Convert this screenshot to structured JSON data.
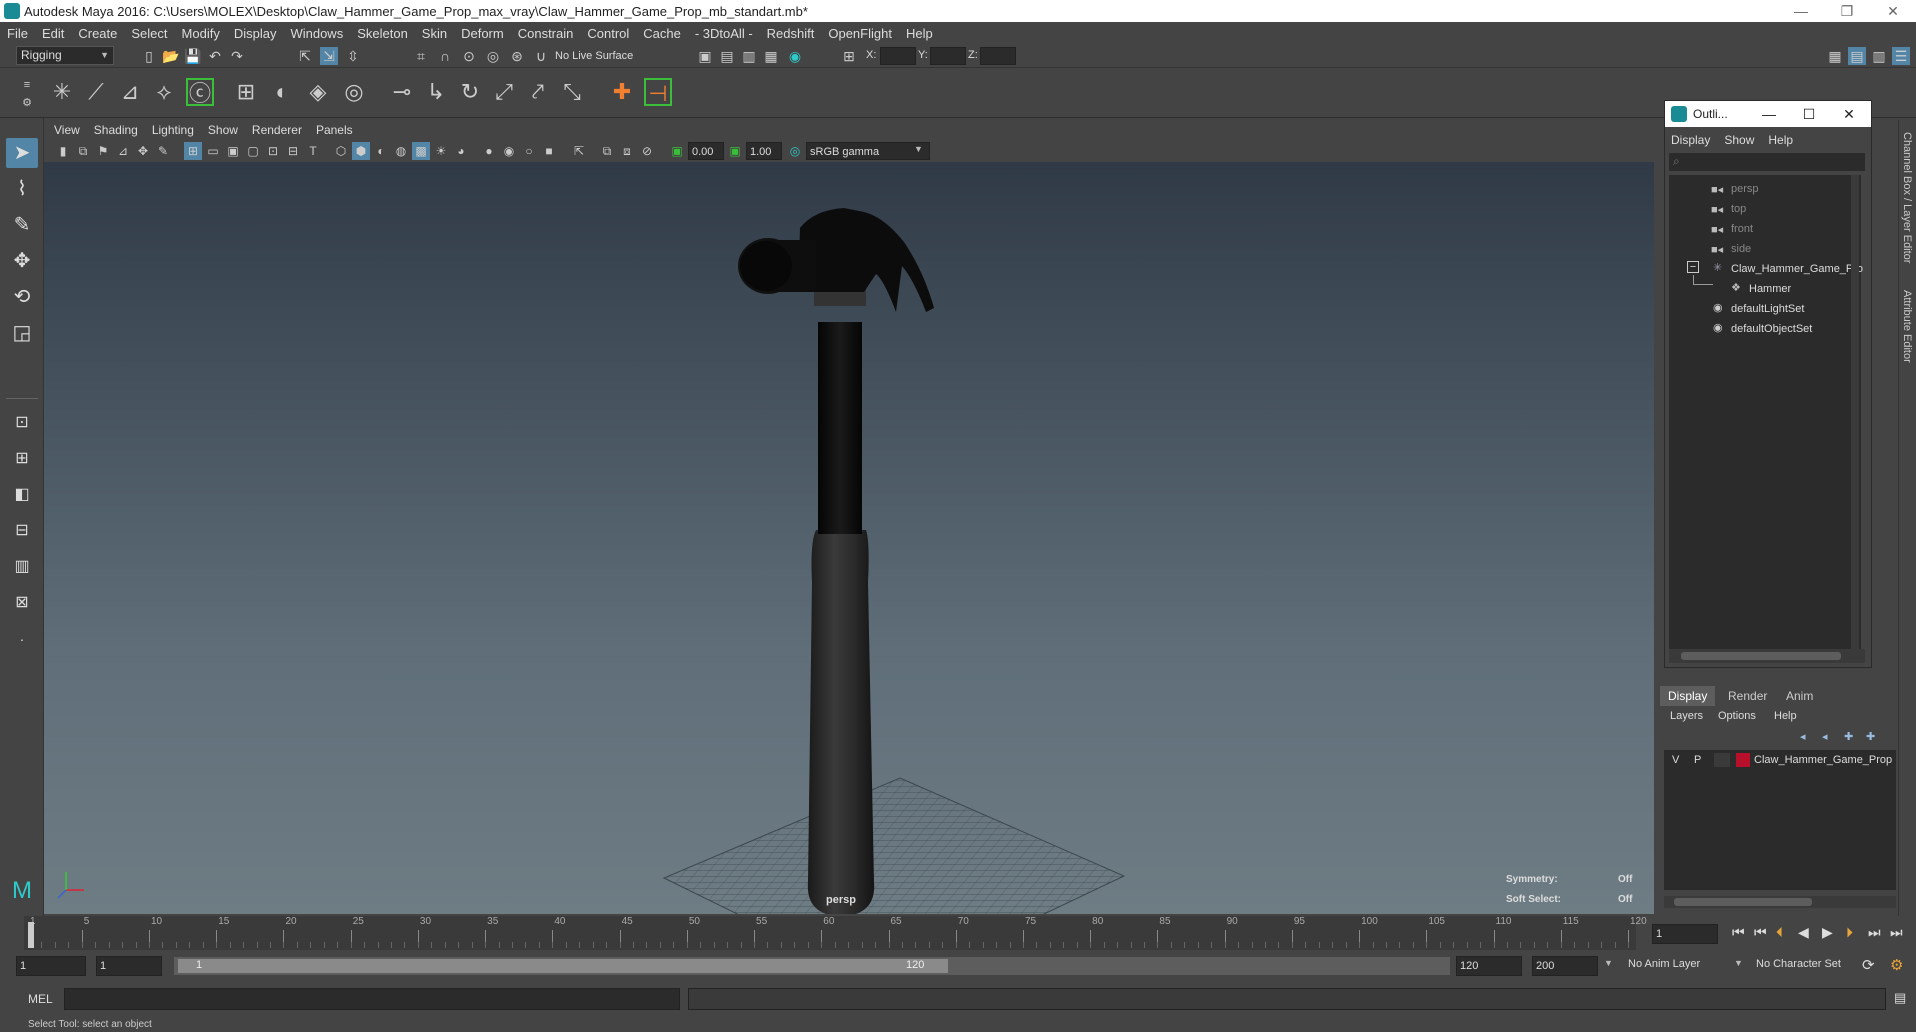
{
  "window": {
    "title": "Autodesk Maya 2016: C:\\Users\\MOLEX\\Desktop\\Claw_Hammer_Game_Prop_max_vray\\Claw_Hammer_Game_Prop_mb_standart.mb*"
  },
  "menubar": [
    "File",
    "Edit",
    "Create",
    "Select",
    "Modify",
    "Display",
    "Windows",
    "Skeleton",
    "Skin",
    "Deform",
    "Constrain",
    "Control",
    "Cache",
    "- 3DtoAll -",
    "Redshift",
    "OpenFlight",
    "Help"
  ],
  "statusline": {
    "mode": "Rigging",
    "live_surface": "No Live Surface",
    "x_label": "X:",
    "y_label": "Y:",
    "z_label": "Z:"
  },
  "viewport": {
    "menu": [
      "View",
      "Shading",
      "Lighting",
      "Show",
      "Renderer",
      "Panels"
    ],
    "exposure": "0.00",
    "gamma": "1.00",
    "color_space": "sRGB gamma",
    "camera_label": "persp",
    "symmetry_label": "Symmetry:",
    "symmetry_value": "Off",
    "soft_select_label": "Soft Select:",
    "soft_select_value": "Off"
  },
  "outliner": {
    "title": "Outli...",
    "menu": [
      "Display",
      "Show",
      "Help"
    ],
    "items": [
      "persp",
      "top",
      "front",
      "side",
      "Claw_Hammer_Game_Pro",
      "Hammer",
      "defaultLightSet",
      "defaultObjectSet"
    ]
  },
  "layer_editor": {
    "tabs": [
      "Display",
      "Render",
      "Anim"
    ],
    "menu": [
      "Layers",
      "Options",
      "Help"
    ],
    "layer_v": "V",
    "layer_p": "P",
    "layer_name": "Claw_Hammer_Game_Prop",
    "layer_color": "#b8102a"
  },
  "side_tabs": [
    "Channel Box / Layer Editor",
    "Attribute Editor"
  ],
  "timeline": {
    "ticks": [
      "1",
      "5",
      "10",
      "15",
      "20",
      "25",
      "30",
      "35",
      "40",
      "45",
      "50",
      "55",
      "60",
      "65",
      "70",
      "75",
      "80",
      "85",
      "90",
      "95",
      "100",
      "105",
      "110",
      "115",
      "120"
    ],
    "current_frame": "1"
  },
  "range": {
    "start": "1",
    "playback_start": "1",
    "range_start_label": "1",
    "range_end_label": "120",
    "playback_end": "120",
    "end": "200",
    "anim_layer": "No Anim Layer",
    "character_set": "No Character Set"
  },
  "cmdline": {
    "label": "MEL"
  },
  "helpline": {
    "text": "Select Tool: select an object"
  },
  "colors": {
    "accent": "#5285a6",
    "maya_teal": "#1a8a94"
  }
}
